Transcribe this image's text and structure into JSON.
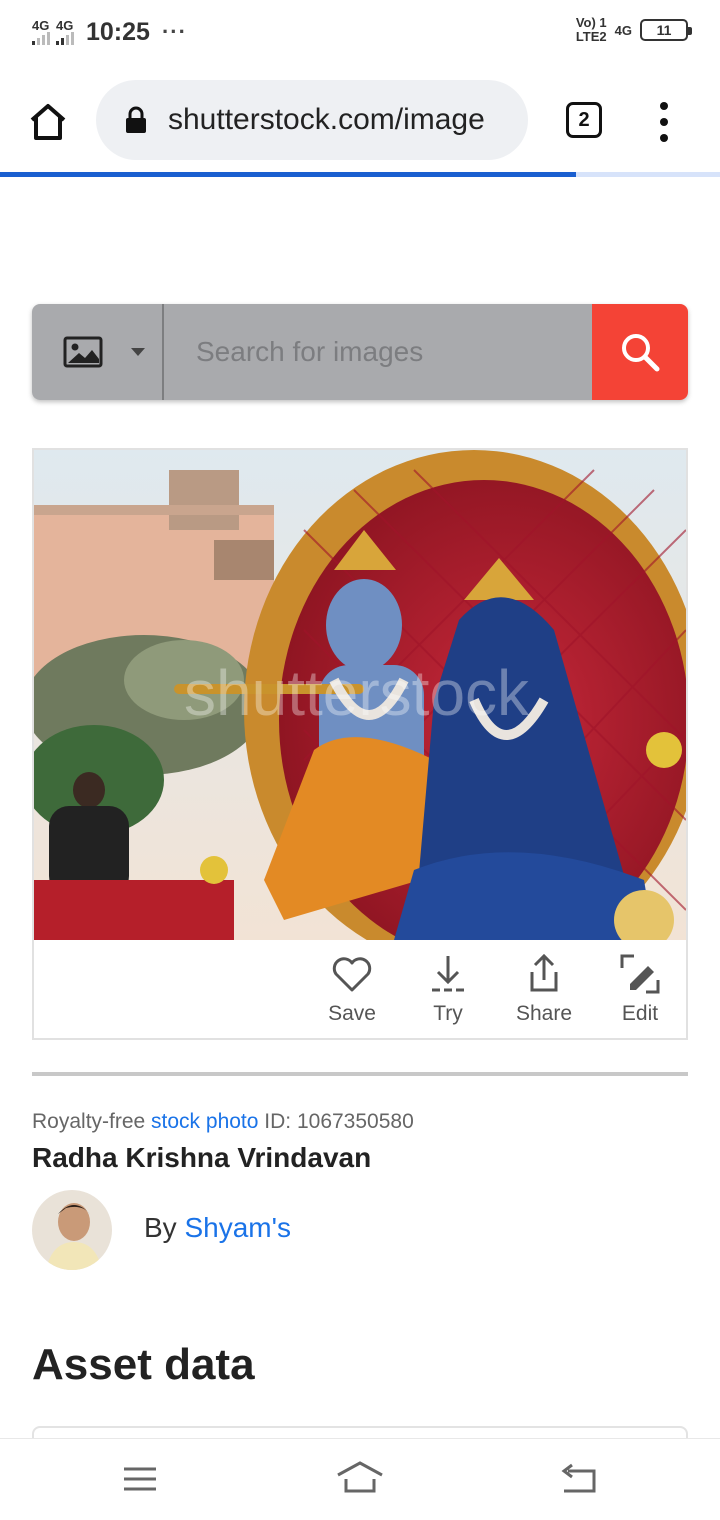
{
  "status_bar": {
    "sim1": "4G",
    "sim2": "4G",
    "time": "10:25",
    "overflow": "···",
    "volte_line1": "Vo) 1",
    "volte_line2": "LTE2",
    "network": "4G",
    "battery": "11"
  },
  "browser": {
    "url": "shutterstock.com/image",
    "tab_count": "2",
    "load_progress": 0.8
  },
  "search": {
    "placeholder": "Search for images",
    "type_icon": "image-icon",
    "button_icon": "search-icon"
  },
  "image_actions": [
    {
      "label": "Save",
      "icon": "heart-icon"
    },
    {
      "label": "Try",
      "icon": "download-icon"
    },
    {
      "label": "Share",
      "icon": "share-icon"
    },
    {
      "label": "Edit",
      "icon": "edit-icon"
    }
  ],
  "asset": {
    "license_prefix": "Royalty-free",
    "type_link": "stock photo",
    "id_label": "ID: 1067350580",
    "title": "Radha Krishna Vrindavan",
    "by_label": "By",
    "author": "Shyam's"
  },
  "section": {
    "heading": "Asset data"
  },
  "colors": {
    "accent_red": "#f44336",
    "link_blue": "#1a73e8",
    "progress_blue": "#1a5fd0"
  }
}
